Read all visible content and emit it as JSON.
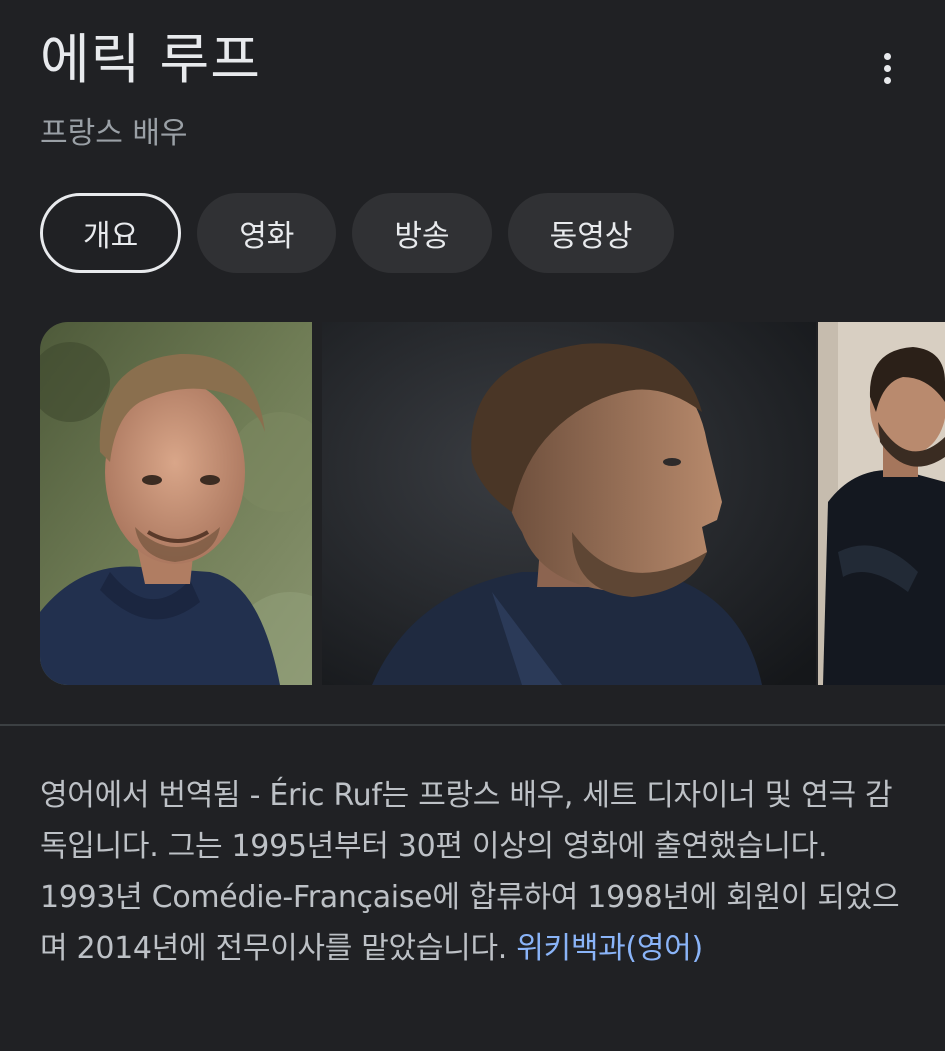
{
  "header": {
    "title": "에릭 루프",
    "subtitle": "프랑스 배우"
  },
  "tabs": [
    {
      "label": "개요",
      "active": true
    },
    {
      "label": "영화",
      "active": false
    },
    {
      "label": "방송",
      "active": false
    },
    {
      "label": "동영상",
      "active": false
    }
  ],
  "description": {
    "text": "영어에서 번역됨 - Éric Ruf는 프랑스 배우, 세트 디자이너 및 연극 감독입니다. 그는 1995년부터 30편 이상의 영화에 출연했습니다. 1993년 Comédie-Française에 합류하여 1998년에 회원이 되었으며 2014년에 전무이사를 맡았습니다. ",
    "link_label": "위키백과(영어)"
  },
  "colors": {
    "background": "#202124",
    "chip_background": "#303134",
    "link": "#8ab4f8",
    "subtitle": "#9aa0a6"
  },
  "icons": {
    "more": "more-vert-icon"
  }
}
